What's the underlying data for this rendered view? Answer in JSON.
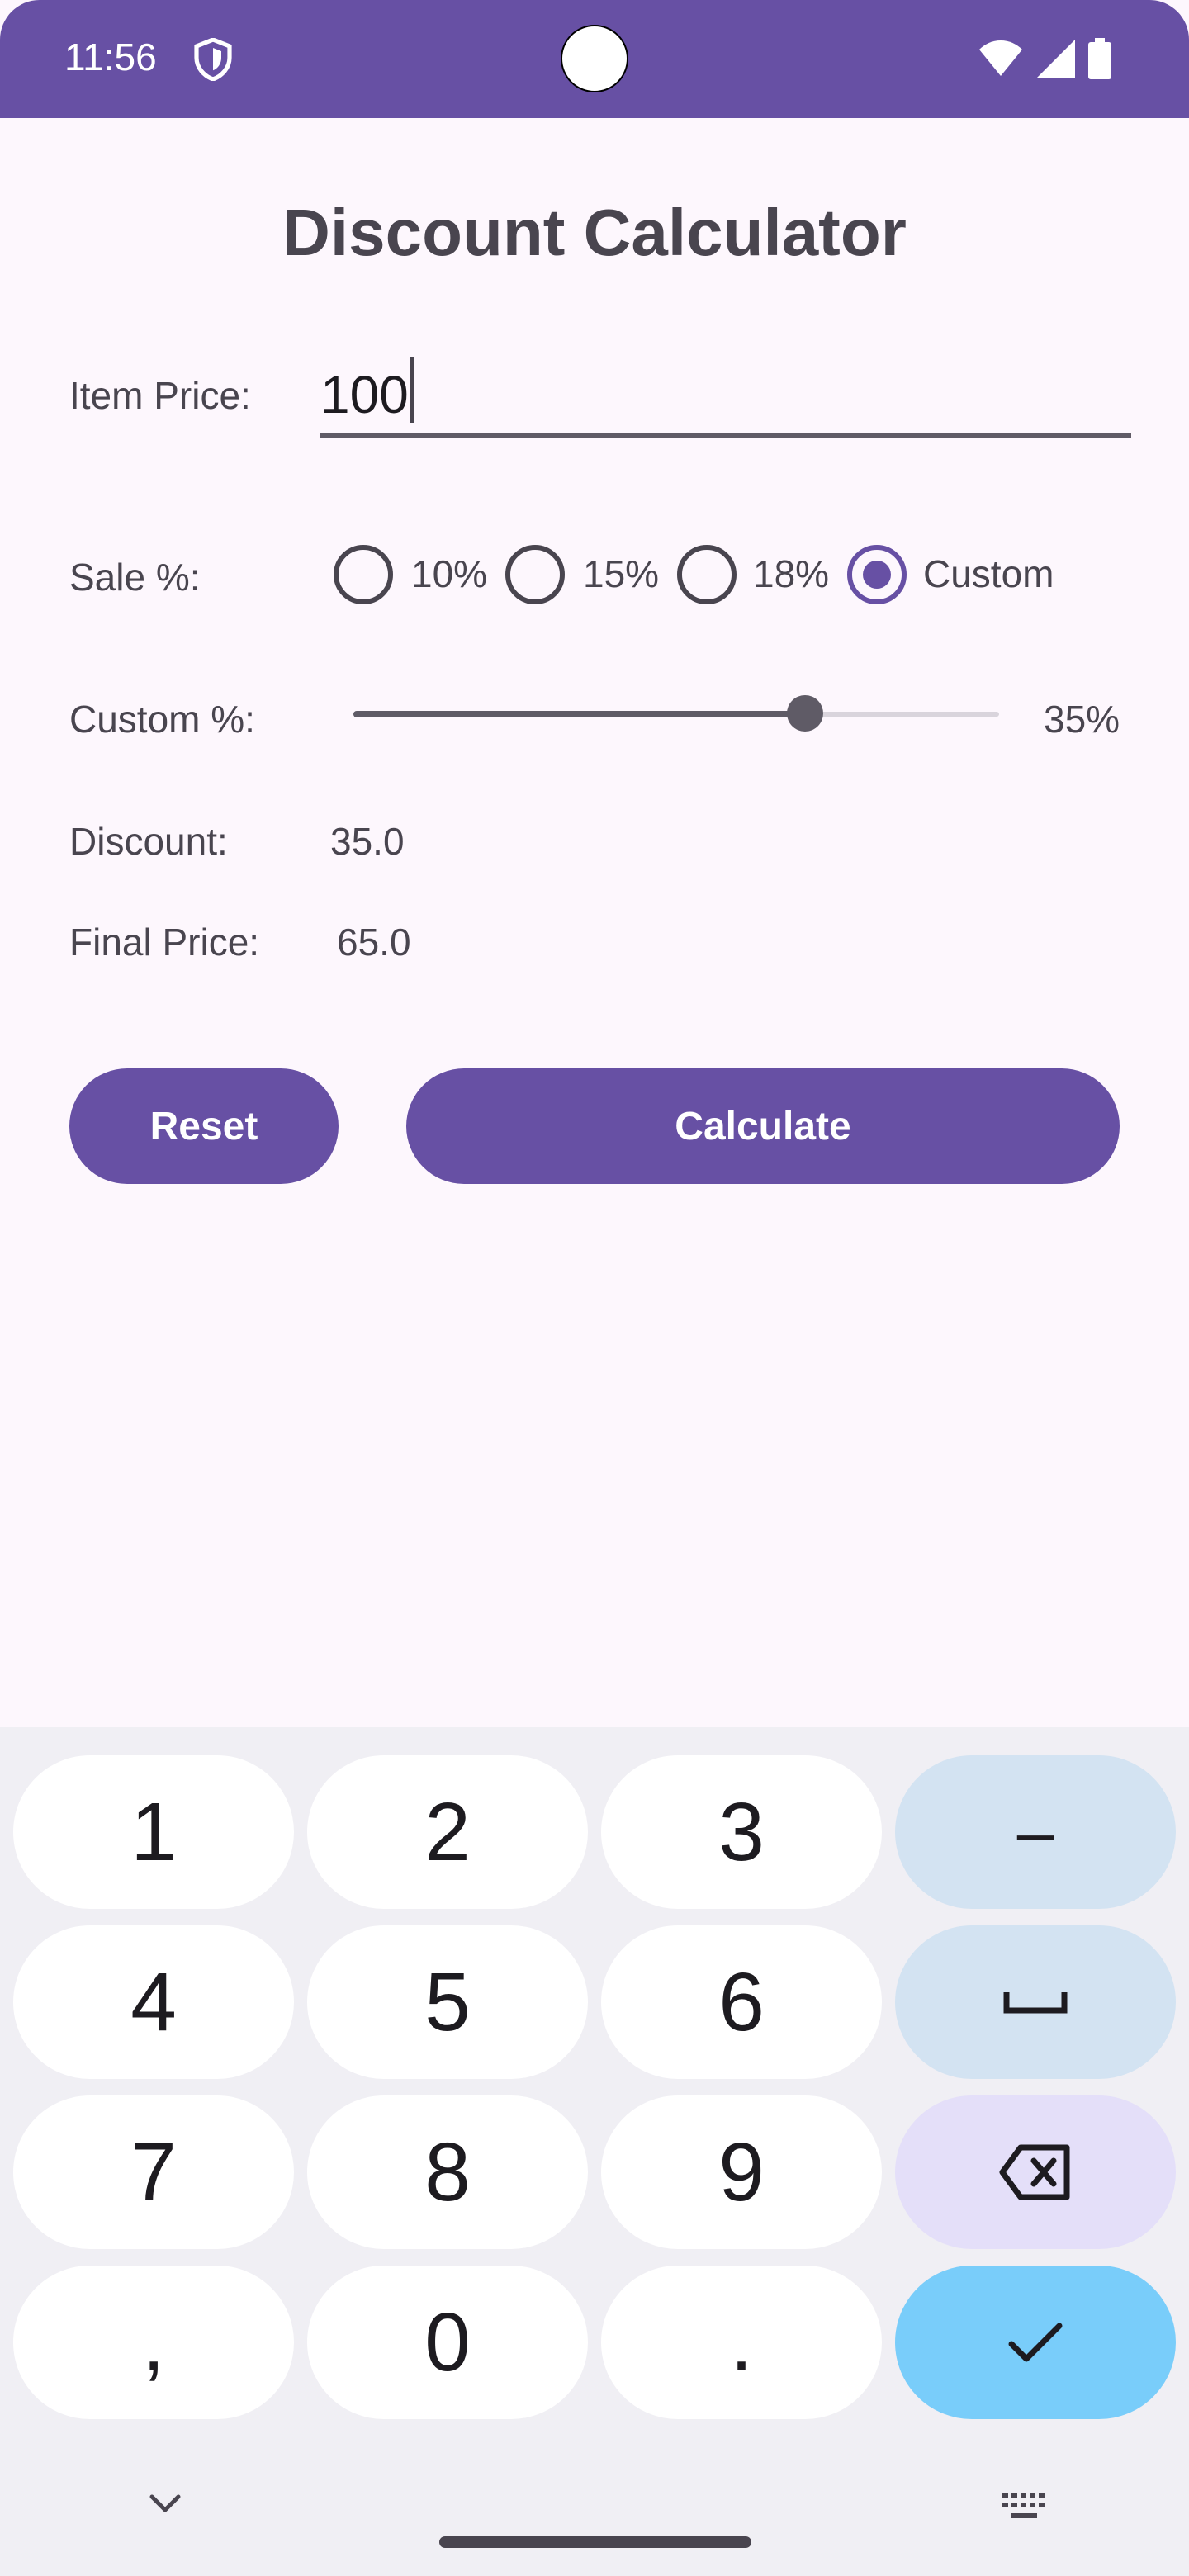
{
  "status_bar": {
    "time": "11:56",
    "icons": [
      "shield-icon",
      "wifi-icon",
      "signal-icon",
      "battery-icon"
    ]
  },
  "app": {
    "title": "Discount Calculator",
    "item_price_label": "Item Price:",
    "item_price_value": "100",
    "sale_label": "Sale %:",
    "sale_options": [
      {
        "label": "10%",
        "selected": false
      },
      {
        "label": "15%",
        "selected": false
      },
      {
        "label": "18%",
        "selected": false
      },
      {
        "label": "Custom",
        "selected": true
      }
    ],
    "custom_label": "Custom %:",
    "custom_value_percent": 35,
    "custom_value_text": "35%",
    "slider_max_percent": 50,
    "discount_label": "Discount:",
    "discount_value": "35.0",
    "final_price_label": "Final Price:",
    "final_price_value": "65.0",
    "reset_label": "Reset",
    "calculate_label": "Calculate"
  },
  "keyboard": {
    "rows": [
      [
        "1",
        "2",
        "3",
        "–"
      ],
      [
        "4",
        "5",
        "6",
        "space-icon"
      ],
      [
        "7",
        "8",
        "9",
        "backspace-icon"
      ],
      [
        ",",
        "0",
        ".",
        "checkmark-icon"
      ]
    ],
    "colors": {
      "background": "#f0eff4",
      "digit_key": "#ffffff",
      "action_key": "#d3e3f2",
      "backspace_key": "#e4dff9",
      "enter_key": "#79cdfa"
    }
  },
  "colors": {
    "primary": "#6750a4",
    "page_background": "#fdf7fd",
    "text": "#49454f"
  }
}
